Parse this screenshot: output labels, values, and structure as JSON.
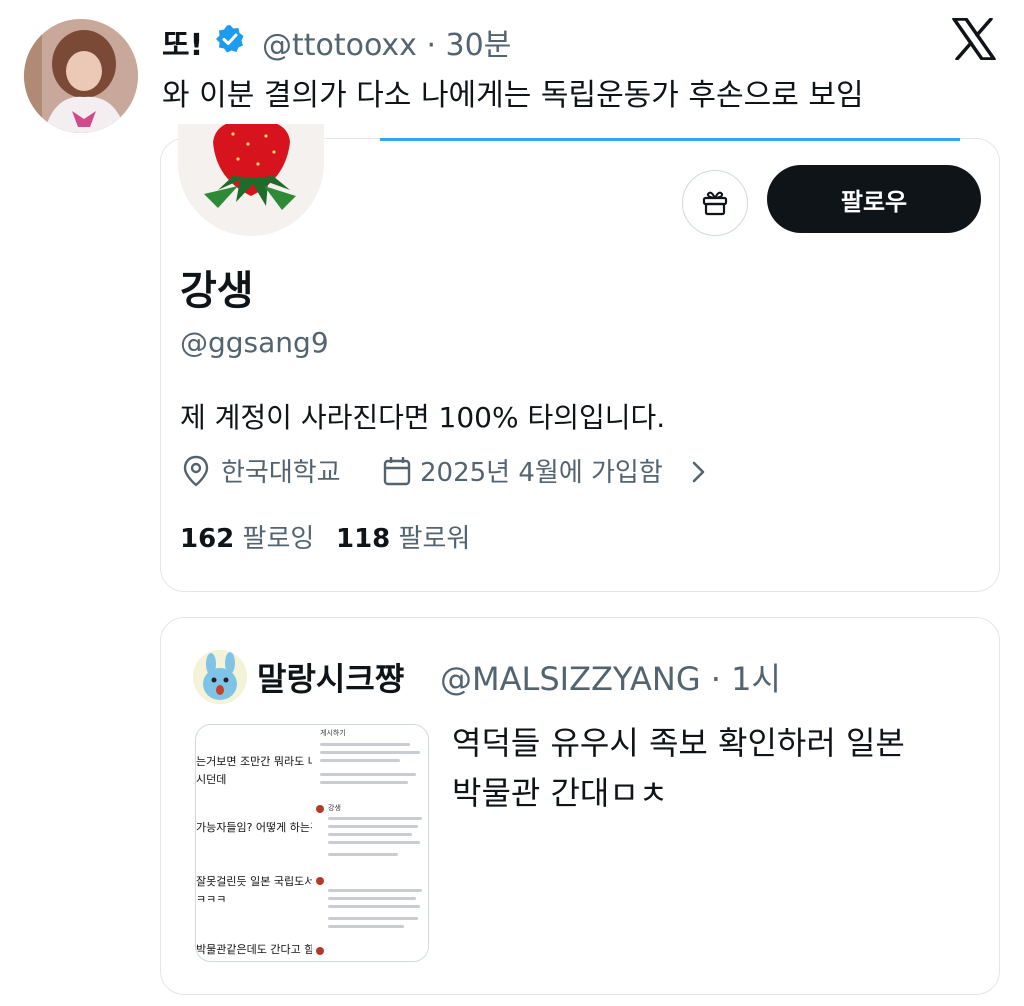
{
  "tweet": {
    "display_name": "또!",
    "handle_time": "@ttotooxx · 30분",
    "text": "와 이분 결의가 다소 나에게는 독립운동가 후손으로 보임",
    "icons": {
      "verified": "verified-badge-icon",
      "platform": "x-logo-icon"
    },
    "colors": {
      "verified": "#1d9bf0",
      "muted": "#536471"
    }
  },
  "profile_card": {
    "name": "강생",
    "handle": "@ggsang9",
    "bio": "제 계정이 사라진다면 100% 타의입니다.",
    "location": "한국대학교",
    "joined": "2025년 4월에 가입함",
    "following_count": "162",
    "following_label": "팔로잉",
    "followers_count": "118",
    "followers_label": "팔로워",
    "follow_button": "팔로우",
    "icons": {
      "gift": "gift-icon",
      "location": "location-pin-icon",
      "calendar": "calendar-icon",
      "chevron": "chevron-right-icon"
    }
  },
  "quote": {
    "name": "말랑시크쨩",
    "handle_time": "@MALSIZZYANG · 1시",
    "text_line1": "역덕들 유우시 족보 확인하러 일본",
    "text_line2": "박물관 간대ㅁㅊ",
    "thumbnail": {
      "left_lines": [
        "는거보면 조만간 뭐라도 나올듯",
        "시던데",
        "가능자들임? 어떻게 하는건데",
        "잘못걸린듯 일본 국립도서관을",
        "ㅋㅋㅋ",
        "박물관같은데도 간다고 함"
      ],
      "right_header": "게시하기",
      "right_name": "강생"
    }
  }
}
